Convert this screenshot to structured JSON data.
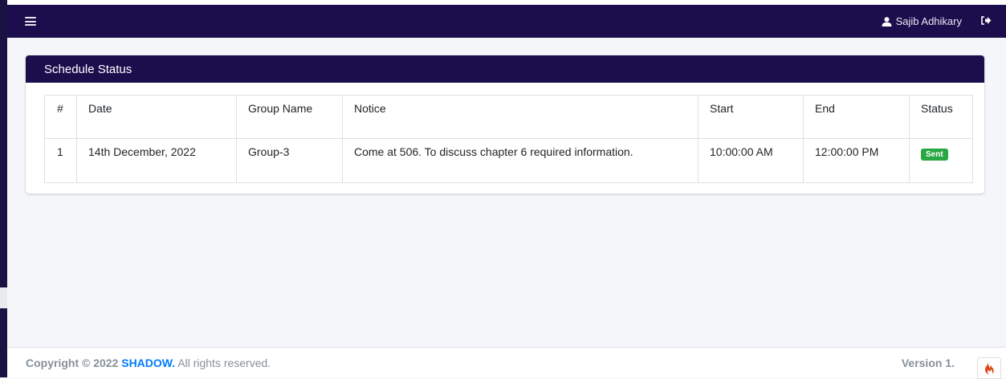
{
  "topbar": {
    "menu_icon": "hamburger-icon",
    "user_icon": "user-icon",
    "user_name": "Sajib Adhikary",
    "logout_icon": "sign-out-icon"
  },
  "card": {
    "title": "Schedule Status"
  },
  "table": {
    "headers": [
      "#",
      "Date",
      "Group Name",
      "Notice",
      "Start",
      "End",
      "Status"
    ],
    "rows": [
      {
        "num": "1",
        "date": "14th December, 2022",
        "group": "Group-3",
        "notice": "Come at 506. To discuss chapter 6 required information.",
        "start": "10:00:00 AM",
        "end": "12:00:00 PM",
        "status": "Sent"
      }
    ]
  },
  "footer": {
    "copyright_prefix": "Copyright © 2022 ",
    "brand": "SHADOW.",
    "rights": " All rights reserved.",
    "version": "Version 1."
  },
  "colors": {
    "navbar": "#1c0e4d",
    "badge_success": "#28a745",
    "brand_link": "#007bff"
  },
  "corner_icon": "codeigniter-flame-icon"
}
